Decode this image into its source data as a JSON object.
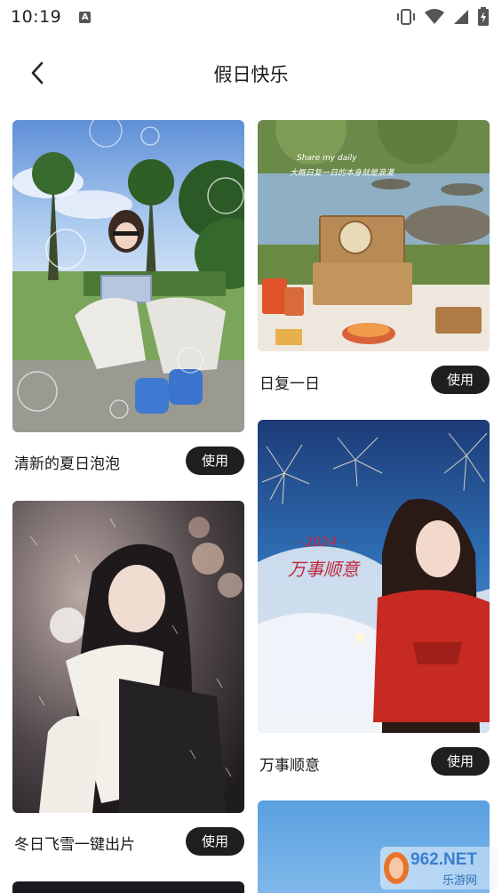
{
  "status_bar": {
    "time": "10:19",
    "notification_badge": "A",
    "icons": [
      "vibrate-icon",
      "wifi-icon",
      "signal-icon",
      "battery-charging-icon"
    ]
  },
  "nav": {
    "title": "假日快乐",
    "back_icon": "chevron-left-icon"
  },
  "templates": [
    {
      "title": "清新的夏日泡泡",
      "button": "使用"
    },
    {
      "title": "日复一日",
      "button": "使用"
    },
    {
      "title": "冬日飞雪一键出片",
      "button": "使用"
    },
    {
      "title": "万事顺意",
      "button": "使用"
    }
  ],
  "overlays": {
    "picnic_line1": "Share my daily",
    "picnic_line2": "大概日复一日的本身就是浪漫",
    "fireworks_line1": "- 2024 -",
    "fireworks_line2": "万事顺意"
  },
  "watermark": {
    "logo_text": "962.NET",
    "sub_text": "乐游网"
  },
  "colors": {
    "button_bg": "#1f1f1f",
    "button_text": "#ffffff",
    "page_bg": "#ffffff"
  }
}
